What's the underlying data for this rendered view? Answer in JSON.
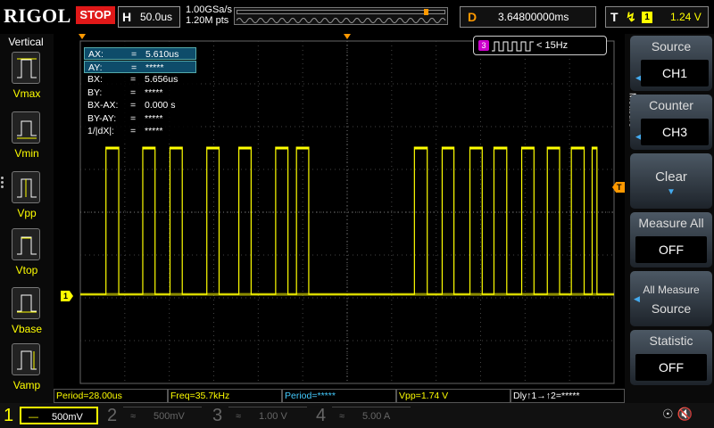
{
  "header": {
    "logo": "RIGOL",
    "run_state": "STOP",
    "horizontal_label": "H",
    "timebase": "50.0us",
    "sample_rate": "1.00GSa/s",
    "memory_depth": "1.20M pts",
    "delay_label": "D",
    "delay_value": "3.64800000ms",
    "trigger_label": "T",
    "trigger_channel": "1",
    "trigger_level": "1.24 V"
  },
  "left_menu": {
    "title": "Vertical",
    "items": [
      {
        "label": "Vmax"
      },
      {
        "label": "Vmin"
      },
      {
        "label": "Vpp"
      },
      {
        "label": "Vtop"
      },
      {
        "label": "Vbase"
      },
      {
        "label": "Vamp"
      }
    ]
  },
  "cursor_panel": {
    "rows": [
      {
        "key": "AX:",
        "eq": "=",
        "value": "5.610us"
      },
      {
        "key": "AY:",
        "eq": "=",
        "value": "*****"
      },
      {
        "key": "BX:",
        "eq": "=",
        "value": "5.656us"
      },
      {
        "key": "BY:",
        "eq": "=",
        "value": "*****"
      },
      {
        "key": "BX-AX:",
        "eq": "=",
        "value": "0.000 s"
      },
      {
        "key": "BY-AY:",
        "eq": "=",
        "value": "*****"
      },
      {
        "key": "1/|dX|:",
        "eq": "=",
        "value": "*****"
      }
    ]
  },
  "counter": {
    "channel": "3",
    "value": "< 15Hz"
  },
  "markers": {
    "ch1": "1",
    "trigger": "T"
  },
  "measurements": [
    {
      "text": "Period=28.00us"
    },
    {
      "text": "Freq=35.7kHz"
    },
    {
      "text": "Period=*****"
    },
    {
      "text": "Vpp=1.74 V"
    },
    {
      "text": "Dly↑1→↑2=*****"
    }
  ],
  "channels": [
    {
      "num": "1",
      "coupling": "—",
      "scale": "500mV",
      "color": "#ffff00"
    },
    {
      "num": "2",
      "coupling": "≈",
      "scale": "500mV",
      "color": "#444444"
    },
    {
      "num": "3",
      "coupling": "≈",
      "scale": "1.00 V",
      "color": "#444444"
    },
    {
      "num": "4",
      "coupling": "≈",
      "scale": "5.00 A",
      "color": "#444444"
    }
  ],
  "right_menu": {
    "side_label": "Measure",
    "source_title": "Source",
    "source_value": "CH1",
    "counter_title": "Counter",
    "counter_value": "CH3",
    "clear_label": "Clear",
    "measure_all_title": "Measure All",
    "measure_all_value": "OFF",
    "all_measure_source_line1": "All Measure",
    "all_measure_source_line2": "Source",
    "statistic_title": "Statistic",
    "statistic_value": "OFF"
  },
  "colors": {
    "ch1": "#ffff00",
    "trigger": "#ff9900",
    "stop": "#e01818",
    "ch3": "#cc00cc"
  },
  "waveform": {
    "channel": "1",
    "high_level_fraction": 0.31,
    "low_level_fraction": 0.74,
    "pulse_groups": [
      "burst-1",
      "burst-2"
    ]
  }
}
